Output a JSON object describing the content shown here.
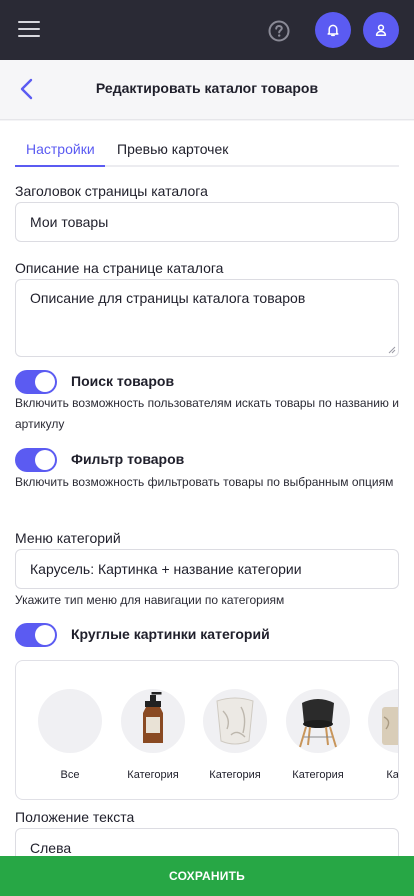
{
  "topbar": {
    "menu_icon": "hamburger-icon",
    "help_icon": "help-circle-icon",
    "bell_icon": "bell-icon",
    "user_icon": "user-icon",
    "accent": "#5b5bf2"
  },
  "header": {
    "back_icon": "chevron-left-icon",
    "title": "Редактировать каталог товаров"
  },
  "tabs": [
    {
      "label": "Настройки",
      "active": true
    },
    {
      "label": "Превью карточек",
      "active": false
    }
  ],
  "form": {
    "page_title_label": "Заголовок страницы каталога",
    "page_title_value": "Мои товары",
    "description_label": "Описание на странице каталога",
    "description_value": "Описание для страницы каталога товаров",
    "search_toggle_label": "Поиск товаров",
    "search_toggle_help": "Включить возможность пользователям искать товары по названию и артикулу",
    "filter_toggle_label": "Фильтр товаров",
    "filter_toggle_help": "Включить возможность фильтровать товары по выбранным опциям",
    "category_menu_label": "Меню категорий",
    "category_menu_value": "Карусель: Картинка + название категории",
    "category_menu_help": "Укажите тип меню для навигации по категориям",
    "round_images_label": "Круглые картинки категорий",
    "text_position_label": "Положение текста",
    "text_position_value": "Слева"
  },
  "preview": {
    "categories": [
      {
        "label": "Все",
        "image": "blank"
      },
      {
        "label": "Категория",
        "image": "amber-bottle"
      },
      {
        "label": "Категория",
        "image": "ceramic-vase"
      },
      {
        "label": "Категория",
        "image": "black-chair"
      },
      {
        "label": "Катег",
        "image": "partial-item"
      }
    ]
  },
  "save_button": {
    "label": "СОХРАНИТЬ",
    "color": "#27a745"
  }
}
